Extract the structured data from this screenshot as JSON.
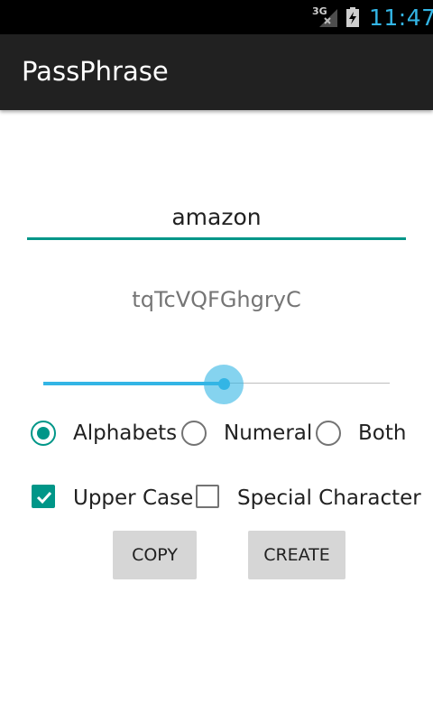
{
  "status_bar": {
    "network": "3G",
    "time": "11:47"
  },
  "action_bar": {
    "title": "PassPhrase"
  },
  "site_input": {
    "value": "amazon"
  },
  "generated_password": "tqTcVQFGhgryC",
  "length_slider": {
    "level": 0.52
  },
  "character_type": {
    "options": [
      "Alphabets",
      "Numeral",
      "Both"
    ],
    "selected": "Alphabets"
  },
  "options": {
    "upper_case": {
      "label": "Upper Case",
      "checked": true
    },
    "special_character": {
      "label": "Special Character",
      "checked": false
    }
  },
  "buttons": {
    "copy": "COPY",
    "create": "CREATE"
  },
  "colors": {
    "accent": "#009688",
    "slider": "#33b5e5",
    "action_bar": "#212121",
    "status_clock": "#33b5e5"
  },
  "icons": {
    "signal": "signal-icon",
    "battery": "battery-charging-icon",
    "check": "check-icon"
  }
}
